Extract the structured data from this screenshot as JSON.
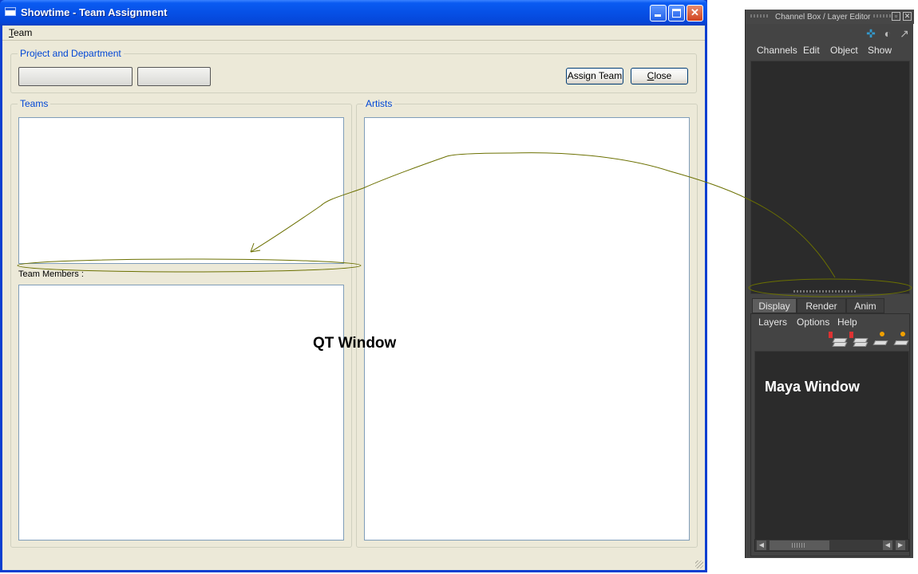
{
  "qt_window": {
    "title": "Showtime - Team Assignment",
    "menu": {
      "team_prefix": "",
      "team_underlined": "T",
      "team_rest": "eam"
    },
    "project_group": {
      "legend": "Project and Department",
      "assign_button": "Assign Team",
      "close_underlined": "C",
      "close_rest": "lose"
    },
    "teams_group": {
      "legend": "Teams",
      "members_label": "Team Members :"
    },
    "artists_group": {
      "legend": "Artists"
    },
    "annotation": "QT Window"
  },
  "maya_window": {
    "title": "Channel Box / Layer Editor",
    "menu": [
      "Channels",
      "Edit",
      "Object",
      "Show"
    ],
    "tabs": [
      "Display",
      "Render",
      "Anim"
    ],
    "active_tab": "Display",
    "layer_menu": [
      "Layers",
      "Options",
      "Help"
    ],
    "annotation": "Maya Window"
  },
  "colors": {
    "xp_titlebar": "#0650e6",
    "xp_client": "#ece9d8",
    "group_legend": "#0046d5",
    "maya_bg": "#444444",
    "maya_panel": "#2b2b2b",
    "annotation_stroke": "#6b7000"
  }
}
